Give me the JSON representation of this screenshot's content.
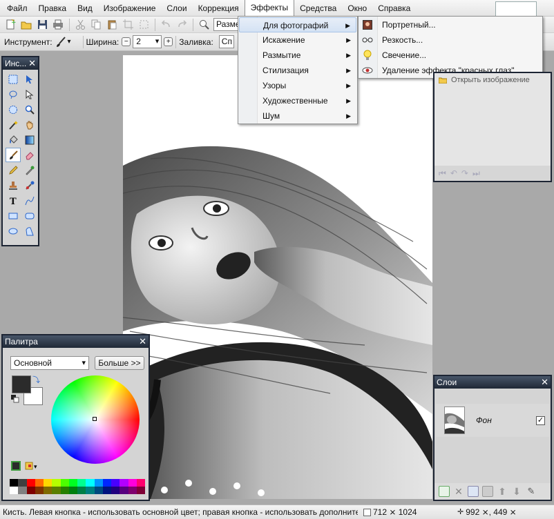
{
  "menubar": {
    "items": [
      "Файл",
      "Правка",
      "Вид",
      "Изображение",
      "Слои",
      "Коррекция",
      "Эффекты",
      "Средства",
      "Окно",
      "Справка"
    ],
    "open_item": "Эффекты"
  },
  "toolbar": {
    "size_combo_value": "Размер"
  },
  "options_bar": {
    "tool_label": "Инструмент:",
    "width_label": "Ширина:",
    "width_value": "2",
    "fill_label": "Заливка:",
    "fill_value": "Сп"
  },
  "effects_menu": {
    "items": [
      {
        "label": "Для фотографий",
        "submenu": true,
        "highlighted": true
      },
      {
        "label": "Искажение",
        "submenu": true
      },
      {
        "label": "Размытие",
        "submenu": true
      },
      {
        "label": "Стилизация",
        "submenu": true
      },
      {
        "label": "Узоры",
        "submenu": true
      },
      {
        "label": "Художественные",
        "submenu": true
      },
      {
        "label": "Шум",
        "submenu": true
      }
    ]
  },
  "photo_submenu": {
    "items": [
      {
        "label": "Портретный...",
        "icon": "portrait-icon"
      },
      {
        "label": "Резкость...",
        "icon": "sharpen-icon"
      },
      {
        "label": "Свечение...",
        "icon": "glow-bulb-icon"
      },
      {
        "label": "Удаление эффекта \"красных глаз\"...",
        "icon": "red-eye-icon"
      }
    ]
  },
  "tools_window": {
    "title": "Инс...",
    "tools": [
      "rectangle-select-icon",
      "move-selection-icon",
      "lasso-select-icon",
      "move-selection-outline-icon",
      "ellipse-select-icon",
      "zoom-icon",
      "magic-wand-icon",
      "pan-hand-icon",
      "paint-bucket-icon",
      "gradient-icon",
      "paintbrush-icon",
      "eraser-icon",
      "pencil-icon",
      "color-picker-icon",
      "clone-stamp-icon",
      "recolor-icon",
      "text-icon",
      "line-curve-icon",
      "rectangle-icon",
      "rounded-rectangle-icon",
      "ellipse-icon",
      "freeform-shape-icon"
    ],
    "active_tool": "paintbrush-icon"
  },
  "history_window": {
    "item_fragment": "Открыть изображение"
  },
  "layers_window": {
    "title": "Слои",
    "layer_name": "Фон",
    "layer_visible": true
  },
  "palette_window": {
    "title": "Палитра",
    "mode": "Основной",
    "more_button": "Больше >>",
    "primary_color": "#2b2b2b",
    "secondary_color": "#ffffff"
  },
  "statusbar": {
    "hint": "Кисть. Левая кнопка - использовать основной цвет; правая кнопка - использовать дополнительный",
    "image_size": "712 ⨯ 1024",
    "cursor_pos": "992 ⨯, 449 ⨯"
  },
  "colors": {
    "accent": "#1c2433",
    "menu_highlight": "#d4e2f4"
  }
}
